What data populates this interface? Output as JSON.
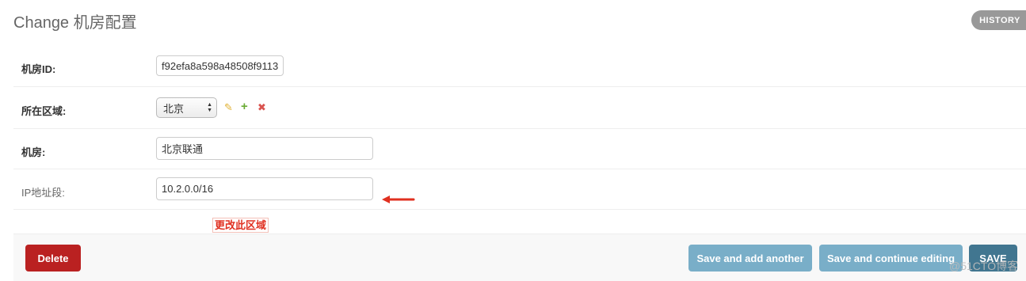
{
  "header": {
    "title": "Change 机房配置",
    "history_label": "HISTORY"
  },
  "fields": {
    "idc_id": {
      "label": "机房ID:",
      "value": "f92efa8a598a48508f9113"
    },
    "region": {
      "label": "所在区域:",
      "selected": "北京"
    },
    "idc_name": {
      "label": "机房:",
      "value": "北京联通"
    },
    "ip_range": {
      "label": "IP地址段:",
      "value": "10.2.0.0/16"
    }
  },
  "annotation": {
    "note": "更改此区域",
    "arrow_color": "#e03020"
  },
  "actions": {
    "delete_label": "Delete",
    "save_add_label": "Save and add another",
    "save_continue_label": "Save and continue editing",
    "save_label": "SAVE"
  },
  "icons": {
    "edit": "pencil-icon",
    "add": "plus-icon",
    "remove": "delete-x-icon"
  },
  "colors": {
    "delete_button": "#ba2121",
    "secondary_button": "#79aec8",
    "primary_button": "#417690",
    "history_button": "#999999"
  },
  "watermark": "@51CTO博客"
}
